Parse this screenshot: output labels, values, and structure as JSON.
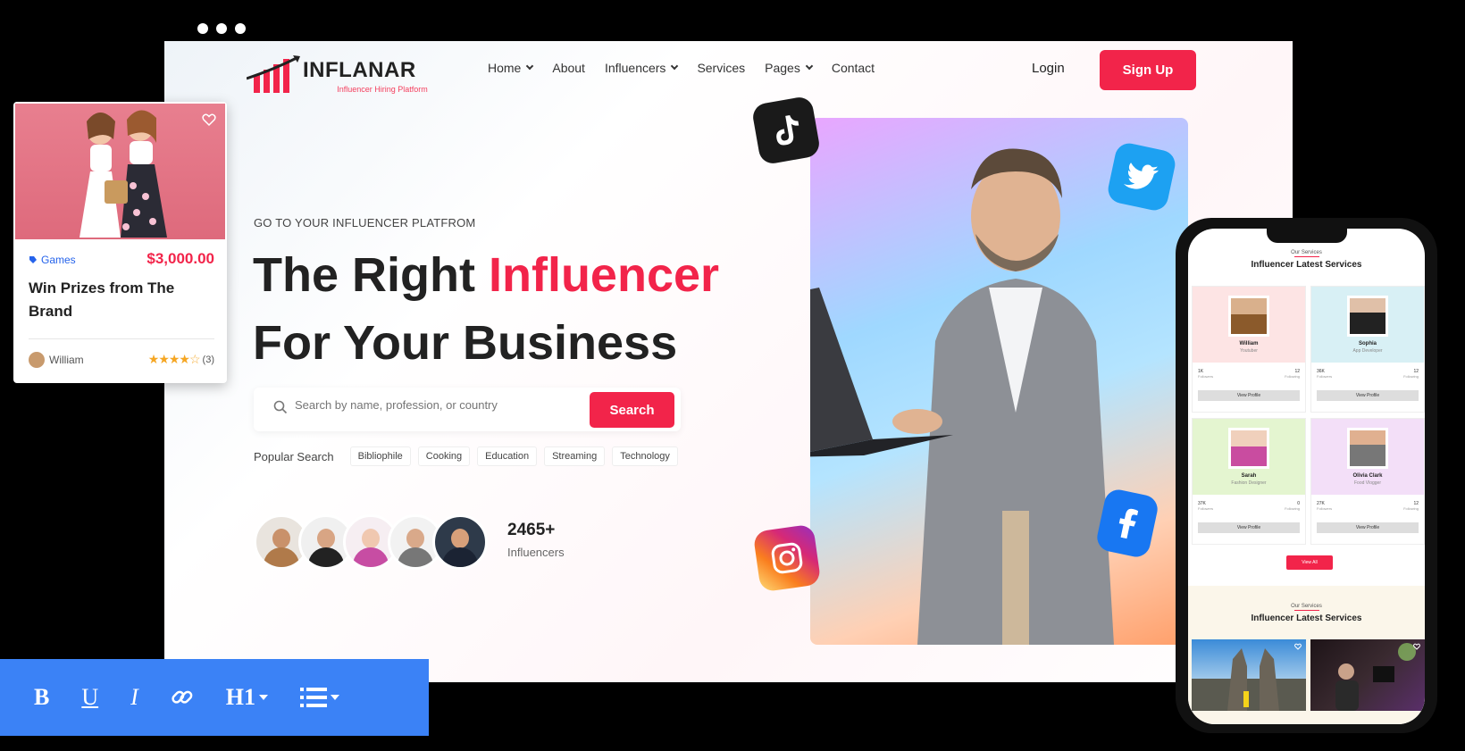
{
  "window": {
    "dots": 3
  },
  "header": {
    "logo_name": "INFLANAR",
    "logo_tagline": "Influencer Hiring Platform",
    "nav": [
      {
        "label": "Home",
        "dropdown": true
      },
      {
        "label": "About",
        "dropdown": false
      },
      {
        "label": "Influencers",
        "dropdown": true
      },
      {
        "label": "Services",
        "dropdown": false
      },
      {
        "label": "Pages",
        "dropdown": true
      },
      {
        "label": "Contact",
        "dropdown": false
      }
    ],
    "login_label": "Login",
    "signup_label": "Sign Up"
  },
  "hero": {
    "eyebrow": "GO TO YOUR INFLUENCER PLATFROM",
    "headline_part1": "The Right ",
    "headline_accent": "Influencer",
    "headline_line2": "For Your Business",
    "search_placeholder": "Search by name, profession, or country",
    "search_button": "Search",
    "popular_label": "Popular Search",
    "popular_tags": [
      "Bibliophile",
      "Cooking",
      "Education",
      "Streaming",
      "Technology"
    ],
    "count": "2465+",
    "count_label": "Influencers",
    "social_icons": [
      "tiktok-icon",
      "twitter-icon",
      "instagram-icon",
      "facebook-icon"
    ]
  },
  "floating_card": {
    "category": "Games",
    "price": "$3,000.00",
    "title": "Win Prizes from The Brand",
    "author": "William",
    "rating": 4,
    "rating_count": "(3)"
  },
  "toolbar": {
    "bold": "B",
    "underline": "U",
    "italic": "I",
    "heading": "H1",
    "tools": [
      "bold-icon",
      "underline-icon",
      "italic-icon",
      "link-icon",
      "heading-icon",
      "list-icon"
    ]
  },
  "phone": {
    "section1_eyebrow": "Our Services",
    "section1_title": "Influencer Latest Services",
    "profiles": [
      {
        "name": "William",
        "role": "Youtuber",
        "stat1": "1K",
        "stat1_label": "Followers",
        "stat2": "12",
        "stat2_label": "Following",
        "button": "View Profile"
      },
      {
        "name": "Sophia",
        "role": "App Developer",
        "stat1": "36K",
        "stat1_label": "Followers",
        "stat2": "12",
        "stat2_label": "Following",
        "button": "View Profile"
      },
      {
        "name": "Sarah",
        "role": "Fashion Designer",
        "stat1": "37K",
        "stat1_label": "Followers",
        "stat2": "0",
        "stat2_label": "Following",
        "button": "View Profile"
      },
      {
        "name": "Olivia Clark",
        "role": "Food Vlogger",
        "stat1": "27K",
        "stat1_label": "Followers",
        "stat2": "12",
        "stat2_label": "Following",
        "button": "View Profile"
      }
    ],
    "view_all": "View All",
    "section2_eyebrow": "Our Services",
    "section2_title": "Influencer Latest Services"
  },
  "colors": {
    "accent": "#f2244a",
    "toolbar": "#3b82f6",
    "link_blue": "#2563eb"
  }
}
